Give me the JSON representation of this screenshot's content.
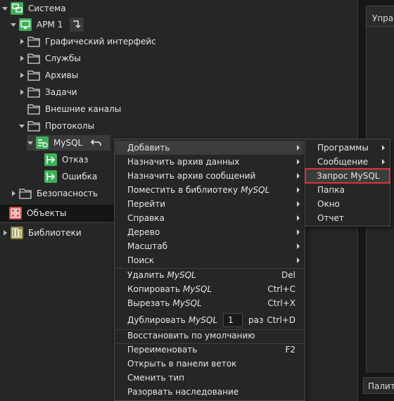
{
  "tree": {
    "root": {
      "label": "Система",
      "icon": "system-icon"
    },
    "arm": {
      "label": "АРМ 1",
      "icon": "workstation-icon"
    },
    "arm_children": [
      {
        "label": "Графический интерфейс",
        "icon": "folder-icon"
      },
      {
        "label": "Службы",
        "icon": "folder-icon"
      },
      {
        "label": "Архивы",
        "icon": "folder-icon"
      },
      {
        "label": "Задачи",
        "icon": "folder-icon"
      },
      {
        "label": "Внешние каналы",
        "icon": "folder-icon"
      },
      {
        "label": "Протоколы",
        "icon": "folder-icon"
      }
    ],
    "mysql": {
      "label": "MySQL",
      "icon": "mysql-protocol-icon"
    },
    "mysql_children": [
      {
        "label": "Отказ",
        "icon": "exit-arrow-icon"
      },
      {
        "label": "Ошибка",
        "icon": "exit-arrow-icon"
      }
    ],
    "security": {
      "label": "Безопасность",
      "icon": "folder-icon"
    },
    "objects": {
      "label": "Объекты",
      "icon": "objects-icon"
    },
    "libraries": {
      "label": "Библиотеки",
      "icon": "libraries-icon"
    }
  },
  "right_panel": {
    "tab_label": "Упра",
    "palette_label": "Палитр"
  },
  "context_menu": {
    "add": "Добавить",
    "assign_data_archive": "Назначить архив данных",
    "assign_message_archive": "Назначить архив сообщений",
    "put_in_library": "Поместить в библиотеку",
    "put_in_library_target": "MySQL",
    "go": "Перейти",
    "help": "Справка",
    "tree": "Дерево",
    "scale": "Масштаб",
    "search": "Поиск",
    "delete": "Удалить",
    "delete_target": "MySQL",
    "delete_shortcut": "Del",
    "copy": "Копировать",
    "copy_target": "MySQL",
    "copy_shortcut": "Ctrl+C",
    "cut": "Вырезать",
    "cut_target": "MySQL",
    "cut_shortcut": "Ctrl+X",
    "duplicate": "Дублировать",
    "duplicate_target": "MySQL",
    "duplicate_count": "1",
    "duplicate_times": "раз",
    "duplicate_shortcut": "Ctrl+D",
    "restore_default": "Восстановить по умолчанию",
    "rename": "Переименовать",
    "rename_shortcut": "F2",
    "open_in_branch_panel": "Открыть в панели веток",
    "change_type": "Сменить тип",
    "break_inheritance": "Разорвать наследование"
  },
  "submenu": {
    "programs": "Программы",
    "message": "Сообщение",
    "mysql_query": "Запрос MySQL",
    "panel": "Папка",
    "window": "Окно",
    "report": "Отчет"
  },
  "colors": {
    "highlight_outline": "#d9343a",
    "icon_green": "#3fae5a",
    "icon_red": "#d0504a",
    "icon_olive": "#8a8a3a"
  }
}
